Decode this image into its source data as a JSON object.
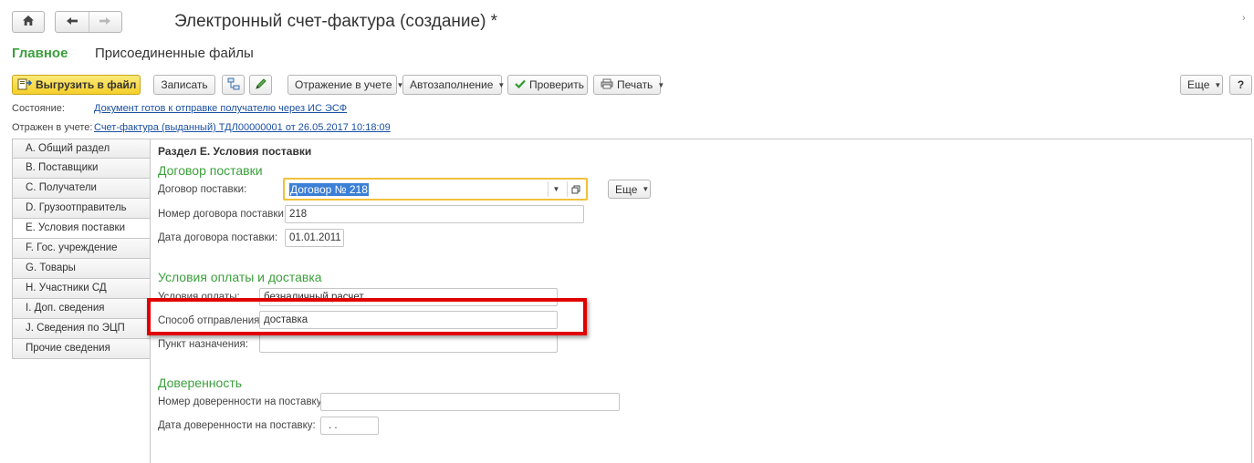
{
  "window": {
    "title": "Электронный счет-фактура (создание) *",
    "nav": {
      "home_icon": "home-icon",
      "back_icon": "arrow-left-icon",
      "forward_icon": "arrow-right-icon"
    },
    "menu_arrow": "›"
  },
  "tabs": [
    {
      "label": "Главное",
      "active": true
    },
    {
      "label": "Присоединенные файлы",
      "active": false
    }
  ],
  "toolbar": {
    "export_label": "Выгрузить в файл",
    "save_label": "Записать",
    "posting_label": "Отражение в учете",
    "autofill_label": "Автозаполнение",
    "check_label": "Проверить",
    "print_label": "Печать",
    "more_label": "Еще",
    "help_label": "?"
  },
  "status": {
    "state_label": "Состояние:",
    "state_value": "Документ готов к отправке получателю через ИС ЭСФ",
    "reflected_label": "Отражен в учете:",
    "reflected_value": "Счет-фактура (выданный) ТДЛ00000001 от 26.05.2017 10:18:09"
  },
  "sections": [
    "А. Общий раздел",
    "В. Поставщики",
    "С. Получатели",
    "D. Грузоотправитель",
    "E. Условия поставки",
    "F. Гос. учреждение",
    "G. Товары",
    "H. Участники СД",
    "I. Доп. сведения",
    "J. Сведения по ЭЦП",
    "Прочие сведения"
  ],
  "active_section_index": 4,
  "form": {
    "section_title": "Раздел E. Условия поставки",
    "contract_group": "Договор поставки",
    "contract_label": "Договор поставки:",
    "contract_value": "Договор № 218",
    "contract_more": "Еще",
    "contract_number_label": "Номер договора поставки:",
    "contract_number_value": "218",
    "contract_date_label": "Дата договора поставки:",
    "contract_date_value": "01.01.2011",
    "payment_group": "Условия оплаты и доставка",
    "payment_terms_label": "Условия оплаты:",
    "payment_terms_value": "безналичный расчет",
    "shipping_method_label": "Способ отправления:",
    "shipping_method_value": "доставка",
    "destination_label": "Пункт назначения:",
    "destination_value": "",
    "poa_group": "Доверенность",
    "poa_number_label": "Номер доверенности на поставку:",
    "poa_number_value": "",
    "poa_date_label": "Дата доверенности на поставку:",
    "poa_date_value": " .  ."
  },
  "colors": {
    "accent_green": "#3c9f3c",
    "link_blue": "#1a4fa3",
    "highlight_red": "#e00000",
    "focus_yellow": "#f0c03a"
  }
}
